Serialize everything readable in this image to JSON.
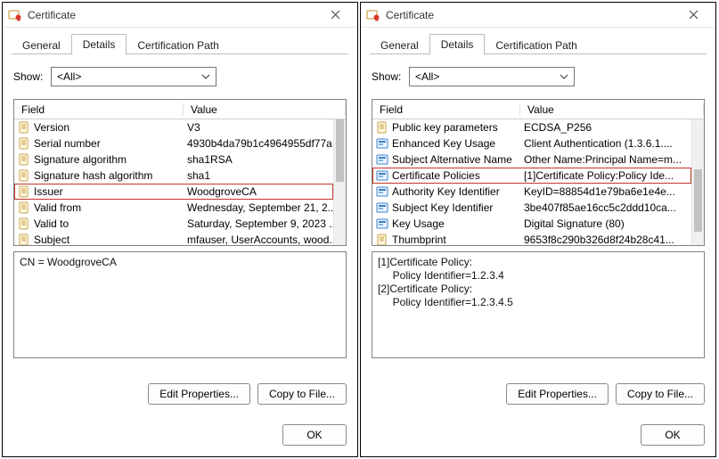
{
  "left": {
    "title": "Certificate",
    "tabs": {
      "general": "General",
      "details": "Details",
      "certpath": "Certification Path"
    },
    "showLabel": "Show:",
    "showValue": "<All>",
    "headers": {
      "field": "Field",
      "value": "Value"
    },
    "rows": [
      {
        "field": "Version",
        "value": "V3",
        "icon": "prop"
      },
      {
        "field": "Serial number",
        "value": "4930b4da79b1c4964955df77a...",
        "icon": "prop"
      },
      {
        "field": "Signature algorithm",
        "value": "sha1RSA",
        "icon": "prop"
      },
      {
        "field": "Signature hash algorithm",
        "value": "sha1",
        "icon": "prop"
      },
      {
        "field": "Issuer",
        "value": "WoodgroveCA",
        "icon": "prop",
        "highlight": true
      },
      {
        "field": "Valid from",
        "value": "Wednesday, September 21, 2...",
        "icon": "prop"
      },
      {
        "field": "Valid to",
        "value": "Saturday, September 9, 2023 ...",
        "icon": "prop"
      },
      {
        "field": "Subject",
        "value": "mfauser, UserAccounts, wood...",
        "icon": "prop"
      }
    ],
    "detailLines": [
      "CN = WoodgroveCA"
    ],
    "buttons": {
      "edit": "Edit Properties...",
      "copy": "Copy to File...",
      "ok": "OK"
    }
  },
  "right": {
    "title": "Certificate",
    "tabs": {
      "general": "General",
      "details": "Details",
      "certpath": "Certification Path"
    },
    "showLabel": "Show:",
    "showValue": "<All>",
    "headers": {
      "field": "Field",
      "value": "Value"
    },
    "rows": [
      {
        "field": "Public key parameters",
        "value": "ECDSA_P256",
        "icon": "prop"
      },
      {
        "field": "Enhanced Key Usage",
        "value": "Client Authentication (1.3.6.1....",
        "icon": "ext"
      },
      {
        "field": "Subject Alternative Name",
        "value": "Other Name:Principal Name=m...",
        "icon": "ext"
      },
      {
        "field": "Certificate Policies",
        "value": "[1]Certificate Policy:Policy Ide...",
        "icon": "ext",
        "highlight": true
      },
      {
        "field": "Authority Key Identifier",
        "value": "KeyID=88854d1e79ba6e1e4e...",
        "icon": "ext"
      },
      {
        "field": "Subject Key Identifier",
        "value": "3be407f85ae16cc5c2ddd10ca...",
        "icon": "ext"
      },
      {
        "field": "Key Usage",
        "value": "Digital Signature (80)",
        "icon": "ext"
      },
      {
        "field": "Thumbprint",
        "value": "9653f8c290b326d8f24b28c41...",
        "icon": "prop"
      }
    ],
    "detailLines": [
      "[1]Certificate Policy:",
      "     Policy Identifier=1.2.3.4",
      "[2]Certificate Policy:",
      "     Policy Identifier=1.2.3.4.5"
    ],
    "buttons": {
      "edit": "Edit Properties...",
      "copy": "Copy to File...",
      "ok": "OK"
    }
  }
}
